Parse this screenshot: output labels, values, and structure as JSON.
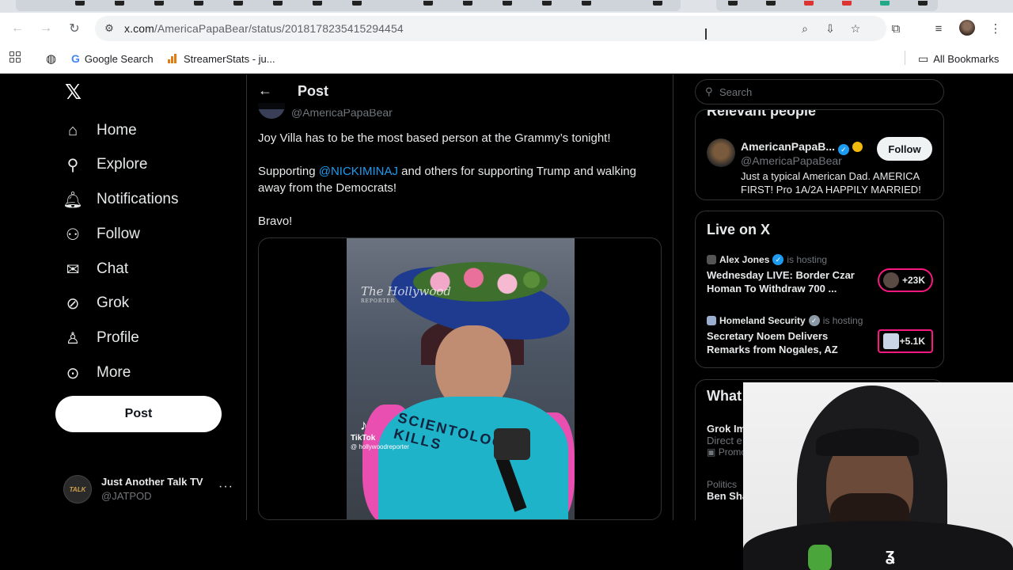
{
  "browser": {
    "url_host": "x.com",
    "url_path": "/AmericaPapaBear/status/2018178235415294454",
    "bookmarks": [
      {
        "label": "Google Search",
        "icon": "google-icon"
      },
      {
        "label": "StreamerStats - ju...",
        "icon": "bar-chart-icon"
      }
    ],
    "all_bookmarks_label": "All Bookmarks"
  },
  "sidebar": {
    "logo": "𝕏",
    "items": [
      {
        "label": "Home",
        "icon": "home-icon"
      },
      {
        "label": "Explore",
        "icon": "search-icon"
      },
      {
        "label": "Notifications",
        "icon": "bell-icon"
      },
      {
        "label": "Follow",
        "icon": "add-person-icon"
      },
      {
        "label": "Chat",
        "icon": "envelope-icon"
      },
      {
        "label": "Grok",
        "icon": "grok-icon"
      },
      {
        "label": "Profile",
        "icon": "person-icon"
      },
      {
        "label": "More",
        "icon": "more-circle-icon"
      }
    ],
    "post_label": "Post",
    "account": {
      "name": "Just Another Talk TV",
      "handle": "@JATPOD",
      "avatar_text": "TALK"
    }
  },
  "post": {
    "header_title": "Post",
    "author_handle": "@AmericaPapaBear",
    "text_line1": "Joy Villa has to be the most based person at the Grammy’s tonight!",
    "text_line2_prefix": "Supporting ",
    "mention": "@NICKIMINAJ",
    "text_line2_suffix": " and others for supporting Trump and walking away from the Democrats!",
    "text_line3": "Bravo!",
    "video": {
      "watermark": "The Hollywood",
      "watermark_sub": "REPORTER",
      "shirt_text": "SCIENTOLOGY KILLS",
      "tiktok_label": "TikTok",
      "tiktok_handle": "@ hollywoodreporter"
    }
  },
  "right_rail": {
    "search_placeholder": "Search",
    "relevant": {
      "title": "Relevant people",
      "name": "AmericanPapaB...",
      "handle": "@AmericaPapaBear",
      "bio": "Just a typical American Dad. AMERICA FIRST! Pro 1A/2A HAPPILY MARRIED!",
      "follow_label": "Follow"
    },
    "live": {
      "title": "Live on X",
      "items": [
        {
          "host": "Alex Jones",
          "hosting": "is hosting",
          "title": "Wednesday LIVE: Border Czar Homan To Withdraw 700 ...",
          "count": "+23K"
        },
        {
          "host": "Homeland Security",
          "hosting": "is hosting",
          "title": "Secretary Noem Delivers Remarks from Nogales, AZ",
          "count": "+5.1K"
        }
      ]
    },
    "happening": {
      "title": "What",
      "t1_title": "Grok Im",
      "t1_sub": "Direct e",
      "t1_promo": "Promo",
      "t2_cat": "Politics",
      "t2_title": "Ben Sha"
    }
  },
  "colors": {
    "accent": "#1d9bf0",
    "live_border": "#f91880",
    "background": "#000000"
  }
}
